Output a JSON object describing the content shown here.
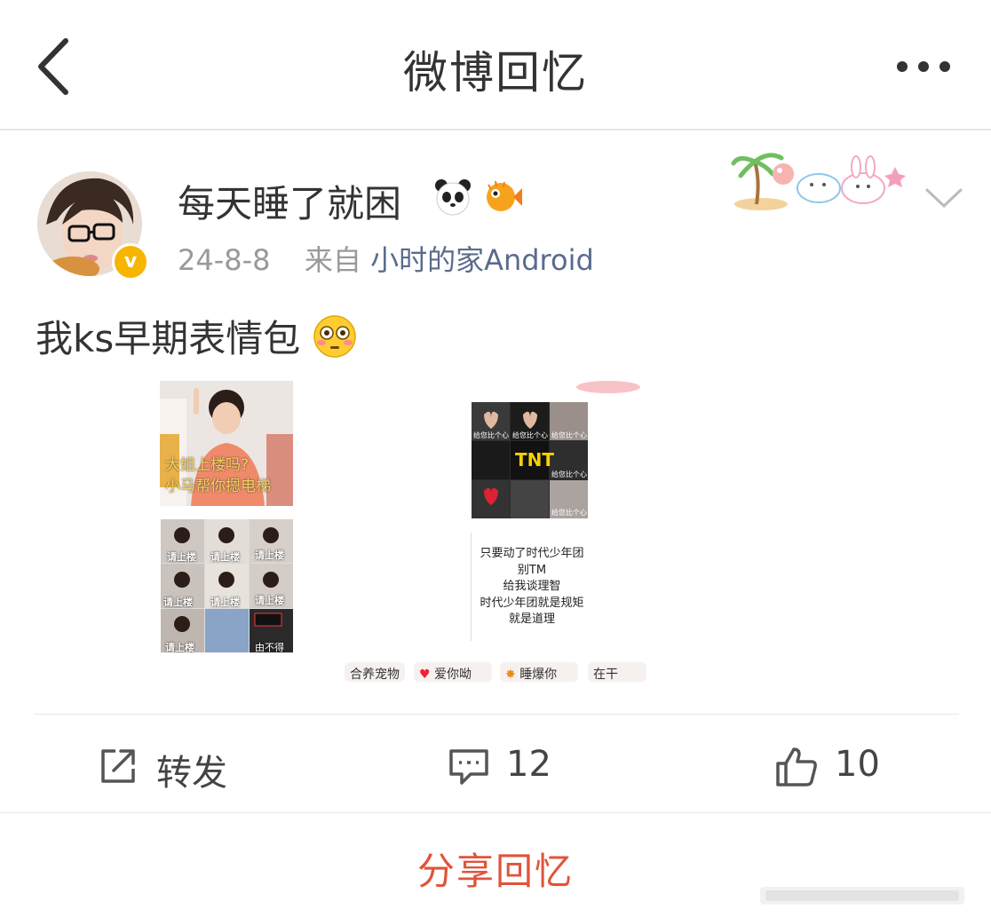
{
  "header": {
    "title": "微博回忆"
  },
  "post": {
    "username": "每天睡了就困",
    "date": "24-8-8",
    "source_prefix": "来自",
    "source": "小时的家Android",
    "text": "我ks早期表情包",
    "images": {
      "top_left_caption_line1": "大姐上楼吗?",
      "top_left_caption_line2": "小马帮你摁电梯",
      "grid_captions": [
        "请上楼",
        "请上楼",
        "请上楼",
        "请上楼",
        "请上楼",
        "请上楼",
        "请上楼",
        "由不得你"
      ],
      "heart_grid_captions": [
        "给您比个心",
        "给您比个心",
        "给您比个心",
        "给您比个心",
        "给您比个心"
      ],
      "panel_text_lines": [
        "只要动了时代少年团",
        "别TM",
        "给我谈理智",
        "时代少年团就是规矩",
        "就是道理"
      ],
      "chips": [
        "合养宠物",
        "爱你呦",
        "睡爆你",
        "在干"
      ]
    }
  },
  "actions": {
    "repost_label": "转发",
    "comment_count": "12",
    "like_count": "10"
  },
  "footer": {
    "share_label": "分享回忆"
  },
  "icons": {
    "back": "back-arrow-icon",
    "more": "more-dots-icon",
    "verified": "verified-badge-icon",
    "expand": "chevron-down-icon",
    "repost": "repost-icon",
    "comment": "comment-icon",
    "like": "thumbs-up-icon"
  },
  "colors": {
    "accent_share": "#e0543a",
    "verified_badge": "#f7b500",
    "source_link": "#5a6b8c"
  }
}
